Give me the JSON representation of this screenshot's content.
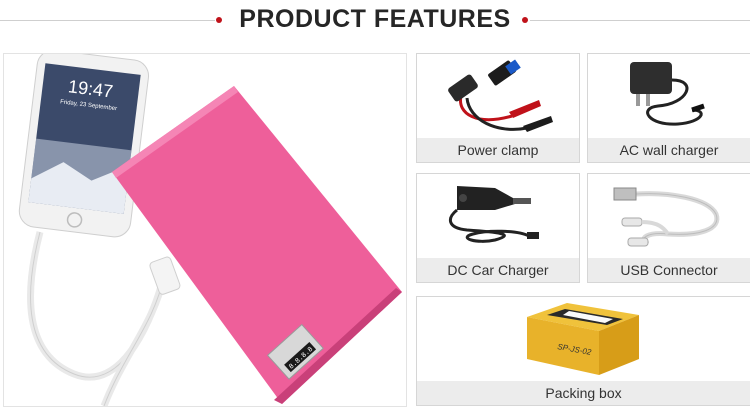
{
  "header": {
    "title": "PRODUCT FEATURES"
  },
  "colors": {
    "accent_red": "#c0121a",
    "power_bank_pink": "#ee5f9a",
    "caption_bg": "#ececec"
  },
  "main_image": {
    "phone_time": "19:47",
    "phone_date": "Friday, 23 September",
    "lcd_text": "8.8.8.8"
  },
  "features": [
    {
      "label": "Power clamp",
      "icon": "jumper-clamp-icon"
    },
    {
      "label": "AC wall charger",
      "icon": "wall-charger-icon"
    },
    {
      "label": "DC Car Charger",
      "icon": "car-charger-icon"
    },
    {
      "label": "USB Connector",
      "icon": "usb-cable-icon"
    },
    {
      "label": "Packing box",
      "icon": "packing-box-icon",
      "box_text": "SP-JS-02"
    }
  ]
}
